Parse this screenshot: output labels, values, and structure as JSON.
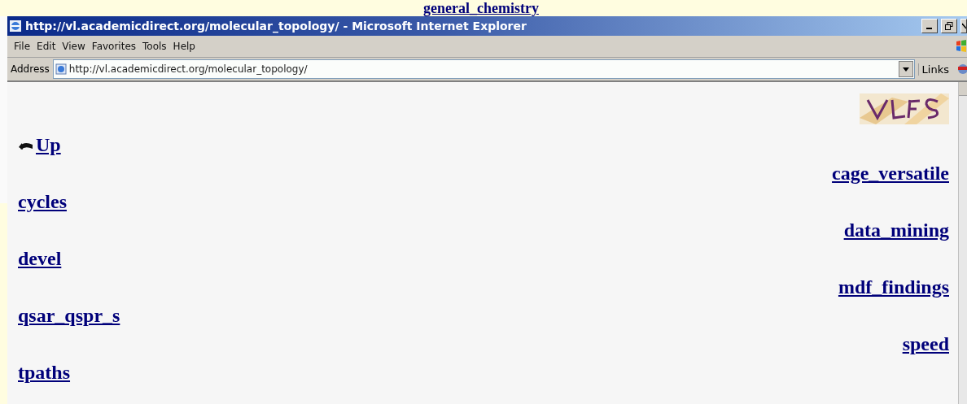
{
  "background_page": {
    "heading": "general_chemistry"
  },
  "window": {
    "title": "http://vl.academicdirect.org/molecular_topology/ - Microsoft Internet Explorer"
  },
  "menu": [
    "File",
    "Edit",
    "View",
    "Favorites",
    "Tools",
    "Help"
  ],
  "address_bar": {
    "label": "Address",
    "value": "http://vl.academicdirect.org/molecular_topology/",
    "links": "Links"
  },
  "links": [
    {
      "label": "Up",
      "kind": "up"
    },
    {
      "label": "cage_versatile",
      "kind": "right"
    },
    {
      "label": "cycles",
      "kind": "left"
    },
    {
      "label": "data_mining",
      "kind": "right"
    },
    {
      "label": "devel",
      "kind": "left"
    },
    {
      "label": "mdf_findings",
      "kind": "right"
    },
    {
      "label": "qsar_qspr_s",
      "kind": "left"
    },
    {
      "label": "speed",
      "kind": "right"
    },
    {
      "label": "tpaths",
      "kind": "left"
    }
  ]
}
